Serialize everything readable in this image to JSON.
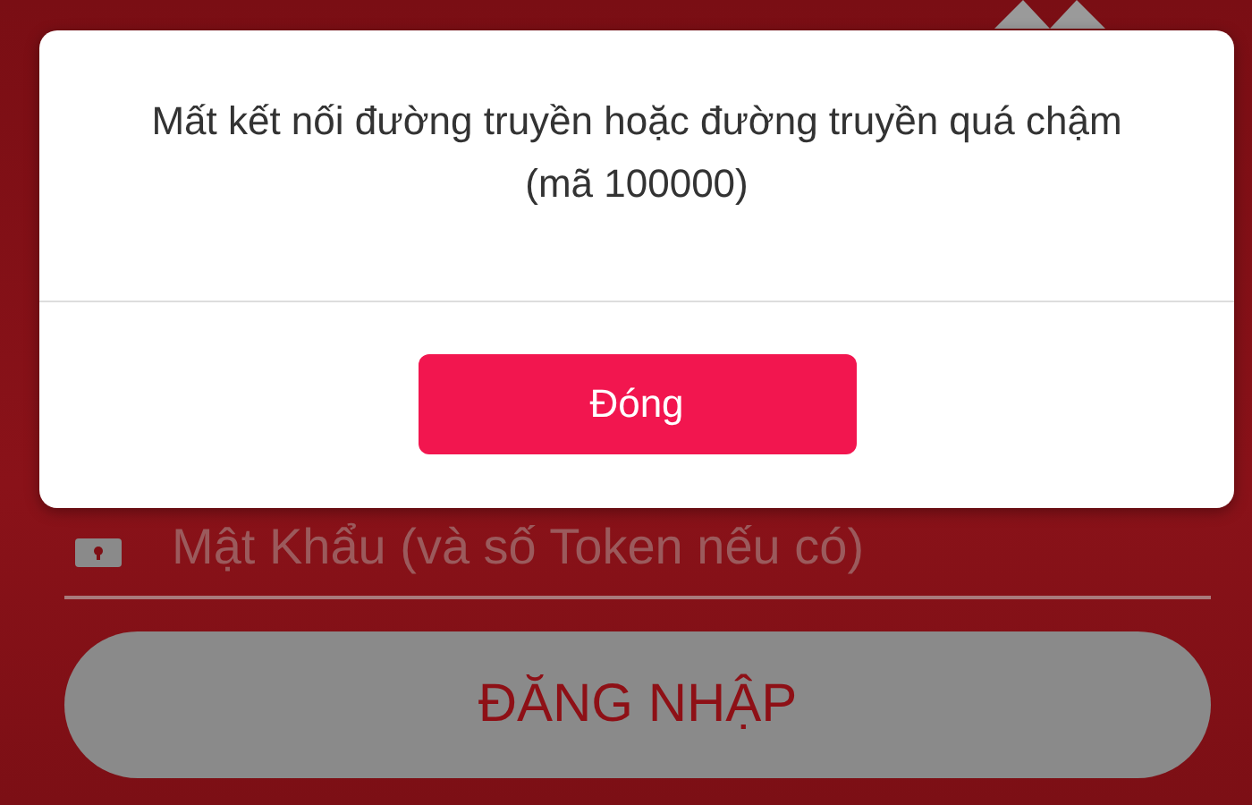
{
  "login": {
    "password_field": {
      "placeholder": "Mật Khẩu (và số Token nếu có)"
    },
    "login_button": "ĐĂNG NHẬP"
  },
  "alert": {
    "message": "Mất kết nối đường truyền hoặc đường truyền quá chậm (mã 100000)",
    "button": "Đóng"
  }
}
